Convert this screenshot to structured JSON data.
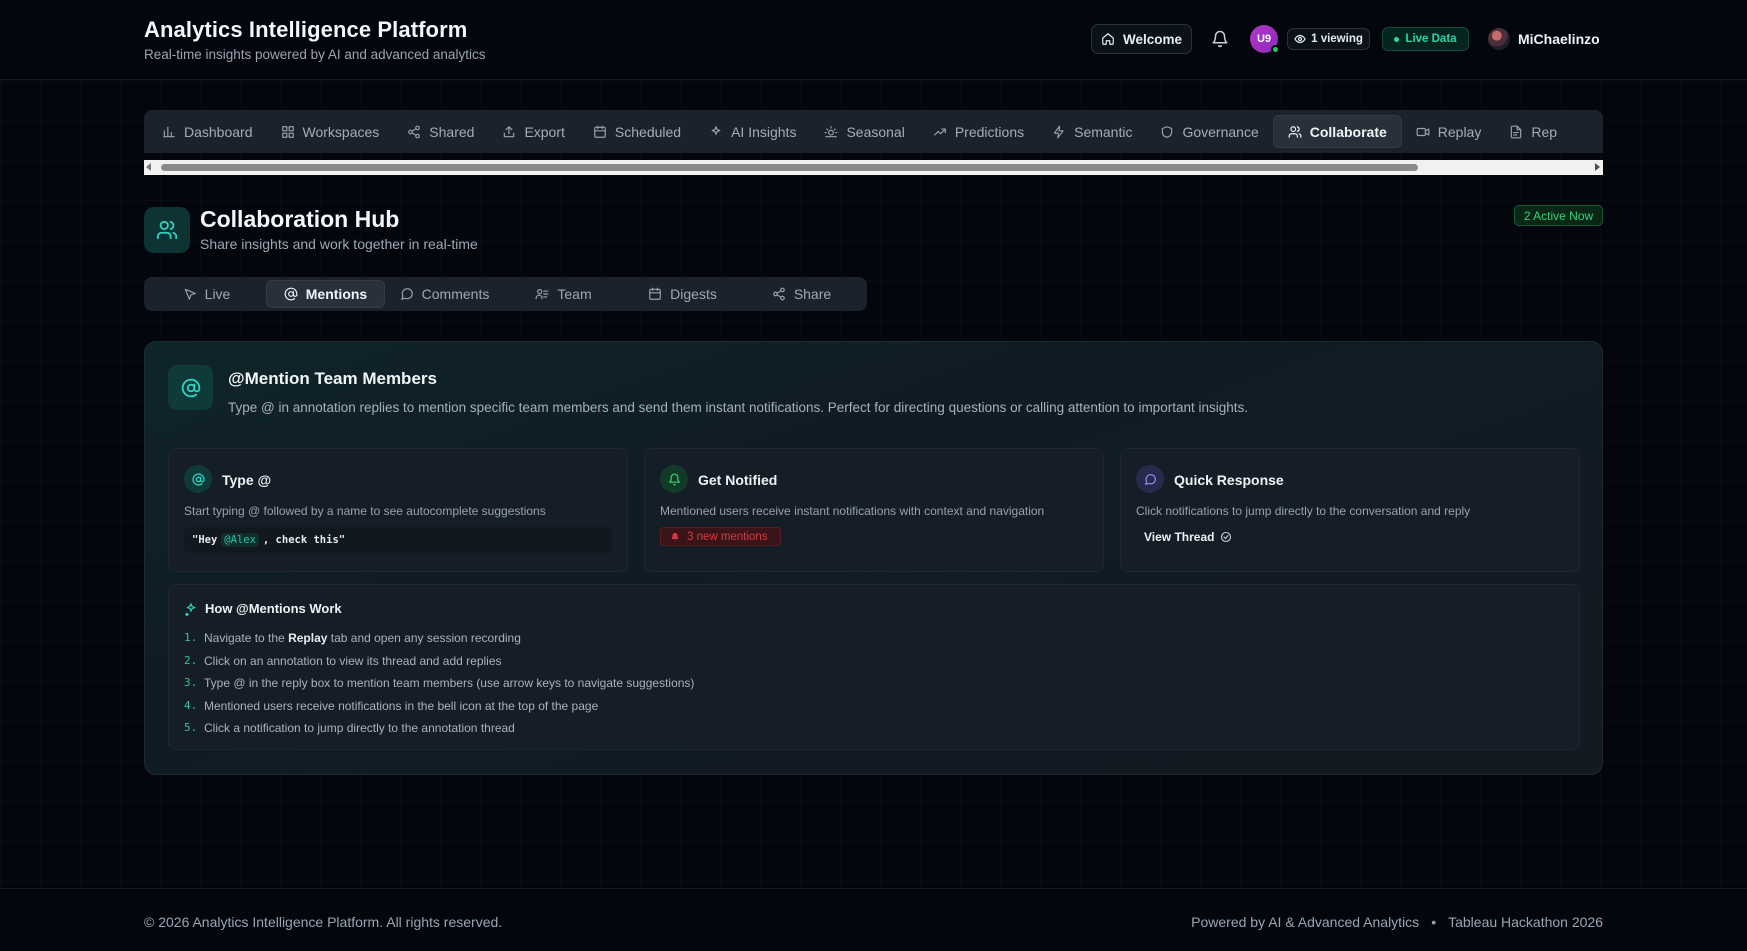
{
  "header": {
    "title": "Analytics Intelligence Platform",
    "subtitle": "Real-time insights powered by AI and advanced analytics",
    "welcome_label": "Welcome",
    "avatar_initials": "U9",
    "viewing_label": "1 viewing",
    "live_label": "Live Data",
    "user_name": "MiChaelinzo"
  },
  "nav": {
    "items": [
      {
        "label": "Dashboard",
        "icon": "bar-chart-icon"
      },
      {
        "label": "Workspaces",
        "icon": "grid-icon"
      },
      {
        "label": "Shared",
        "icon": "share-icon"
      },
      {
        "label": "Export",
        "icon": "export-icon"
      },
      {
        "label": "Scheduled",
        "icon": "calendar-icon"
      },
      {
        "label": "AI Insights",
        "icon": "sparkle-icon"
      },
      {
        "label": "Seasonal",
        "icon": "sun-icon"
      },
      {
        "label": "Predictions",
        "icon": "trend-icon"
      },
      {
        "label": "Semantic",
        "icon": "lightning-icon"
      },
      {
        "label": "Governance",
        "icon": "shield-icon"
      },
      {
        "label": "Collaborate",
        "icon": "users-icon"
      },
      {
        "label": "Replay",
        "icon": "video-icon"
      },
      {
        "label": "Rep",
        "icon": "document-icon"
      }
    ],
    "active": "Collaborate"
  },
  "hub": {
    "title": "Collaboration Hub",
    "subtitle": "Share insights and work together in real-time",
    "active_now": "2 Active Now"
  },
  "subtabs": {
    "items": [
      {
        "label": "Live",
        "icon": "cursor-icon"
      },
      {
        "label": "Mentions",
        "icon": "at-icon"
      },
      {
        "label": "Comments",
        "icon": "chat-icon"
      },
      {
        "label": "Team",
        "icon": "team-icon"
      },
      {
        "label": "Digests",
        "icon": "calendar-icon"
      },
      {
        "label": "Share",
        "icon": "share-icon"
      }
    ],
    "active": "Mentions"
  },
  "panel": {
    "title": "@Mention Team Members",
    "description": "Type @ in annotation replies to mention specific team members and send them instant notifications. Perfect for directing questions or calling attention to important insights.",
    "cards": [
      {
        "title": "Type @",
        "description": "Start typing @ followed by a name to see autocomplete suggestions",
        "code_before": "\"Hey",
        "code_mention": "@Alex",
        "code_after": ", check this\""
      },
      {
        "title": "Get Notified",
        "description": "Mentioned users receive instant notifications with context and navigation",
        "badge": "3 new mentions"
      },
      {
        "title": "Quick Response",
        "description": "Click notifications to jump directly to the conversation and reply",
        "link": "View Thread"
      }
    ],
    "how": {
      "title": "How @Mentions Work",
      "steps": [
        {
          "num": "1.",
          "pre": "Navigate to the ",
          "bold": "Replay",
          "post": " tab and open any session recording"
        },
        {
          "num": "2.",
          "pre": "Click on an annotation to view its thread and add replies",
          "bold": "",
          "post": ""
        },
        {
          "num": "3.",
          "pre": "Type @ in the reply box to mention team members (use arrow keys to navigate suggestions)",
          "bold": "",
          "post": ""
        },
        {
          "num": "4.",
          "pre": "Mentioned users receive notifications in the bell icon at the top of the page",
          "bold": "",
          "post": ""
        },
        {
          "num": "5.",
          "pre": "Click a notification to jump directly to the annotation thread",
          "bold": "",
          "post": ""
        }
      ]
    }
  },
  "footer": {
    "copyright": "© 2026 Analytics Intelligence Platform. All rights reserved.",
    "powered": "Powered by AI & Advanced Analytics",
    "separator": "•",
    "event": "Tableau Hackathon 2026"
  },
  "colors": {
    "accent_teal": "#2dd4a7",
    "active_green": "#34d27a",
    "alert_red": "#d33b46",
    "avatar_purple": "#b636c9"
  }
}
